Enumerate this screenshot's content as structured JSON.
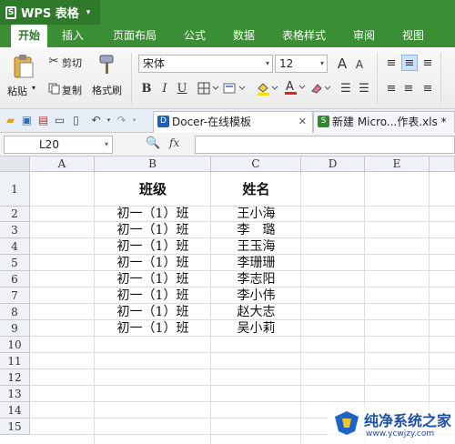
{
  "app": {
    "name": "WPS 表格",
    "caret": "▾",
    "logo": "S"
  },
  "menu": [
    "开始",
    "插入",
    "页面布局",
    "公式",
    "数据",
    "表格样式",
    "审阅",
    "视图"
  ],
  "ribbon": {
    "paste": "粘贴",
    "cut": "剪切",
    "copy": "复制",
    "format_painter": "格式刷",
    "font_name": "宋体",
    "font_size": "12",
    "bold": "B",
    "italic": "I",
    "underline": "U",
    "grow_font": "A",
    "shrink_font": "A"
  },
  "tabs": [
    {
      "label": "Docer-在线模板",
      "close": "✕"
    },
    {
      "label": "新建 Micro...作表.xls *"
    }
  ],
  "formula": {
    "cell_ref": "L20",
    "fx": "fx"
  },
  "columns": [
    "A",
    "B",
    "C",
    "D",
    "E"
  ],
  "rows": [
    "1",
    "2",
    "3",
    "4",
    "5",
    "6",
    "7",
    "8",
    "9",
    "10",
    "11",
    "12",
    "13",
    "14",
    "15"
  ],
  "sheet": {
    "headers": {
      "class": "班级",
      "name": "姓名"
    },
    "records": [
      {
        "class": "初一（1）班",
        "name": "王小海"
      },
      {
        "class": "初一（1）班",
        "name": "李　璐"
      },
      {
        "class": "初一（1）班",
        "name": "王玉海"
      },
      {
        "class": "初一（1）班",
        "name": "李珊珊"
      },
      {
        "class": "初一（1）班",
        "name": "李志阳"
      },
      {
        "class": "初一（1）班",
        "name": "李小伟"
      },
      {
        "class": "初一（1）班",
        "name": "赵大志"
      },
      {
        "class": "初一（1）班",
        "name": "吴小莉"
      }
    ]
  },
  "watermark": {
    "title": "纯净系统之家",
    "url": "www.ycwjzy.com"
  }
}
